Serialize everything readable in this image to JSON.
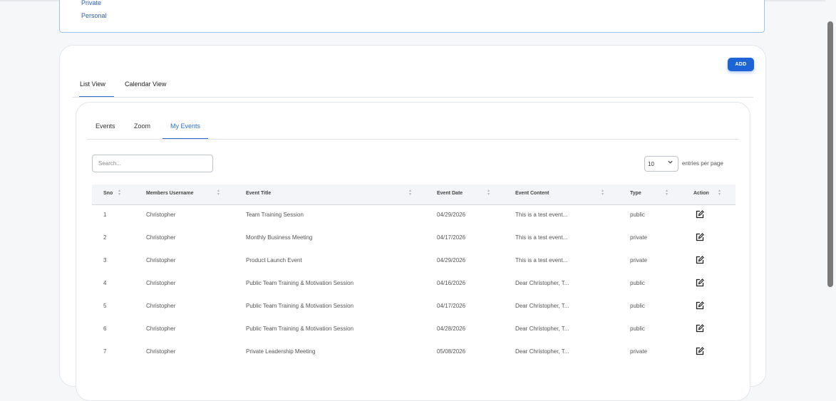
{
  "filter": {
    "options": [
      "Private",
      "Personal"
    ]
  },
  "toolbar": {
    "add_label": "ADD"
  },
  "view_tabs": [
    {
      "label": "List View",
      "active": true
    },
    {
      "label": "Calendar View",
      "active": false
    }
  ],
  "sub_tabs": [
    {
      "label": "Events",
      "active": false
    },
    {
      "label": "Zoom",
      "active": false
    },
    {
      "label": "My Events",
      "active": true
    }
  ],
  "search": {
    "placeholder": "Search...",
    "value": ""
  },
  "entries": {
    "selected": "10",
    "label": "entries per page"
  },
  "table": {
    "columns": [
      "Sno",
      "Members Username",
      "Event Title",
      "Event Date",
      "Event Content",
      "Type",
      "Action"
    ],
    "rows": [
      [
        "1",
        "Christopher",
        "Team Training Session",
        "04/29/2026",
        "This is a test event...",
        "public"
      ],
      [
        "2",
        "Christopher",
        "Monthly Business Meeting",
        "04/17/2026",
        "This is a test event...",
        "private"
      ],
      [
        "3",
        "Christopher",
        "Product Launch Event",
        "04/29/2026",
        "This is a test event...",
        "private"
      ],
      [
        "4",
        "Christopher",
        "Public Team Training & Motivation Session",
        "04/16/2026",
        "Dear Christopher, T...",
        "public"
      ],
      [
        "5",
        "Christopher",
        "Public Team Training & Motivation Session",
        "04/17/2026",
        "Dear Christopher, T...",
        "public"
      ],
      [
        "6",
        "Christopher",
        "Public Team Training & Motivation Session",
        "04/28/2026",
        "Dear Christopher, T...",
        "public"
      ],
      [
        "7",
        "Christopher",
        "Private Leadership Meeting",
        "05/08/2026",
        "Dear Christopher, T...",
        "private"
      ]
    ],
    "action_icon": "edit-icon"
  },
  "colors": {
    "accent": "#1d64d6",
    "tab_active": "#2b6fcf",
    "filter_border": "#9cc4ee"
  }
}
